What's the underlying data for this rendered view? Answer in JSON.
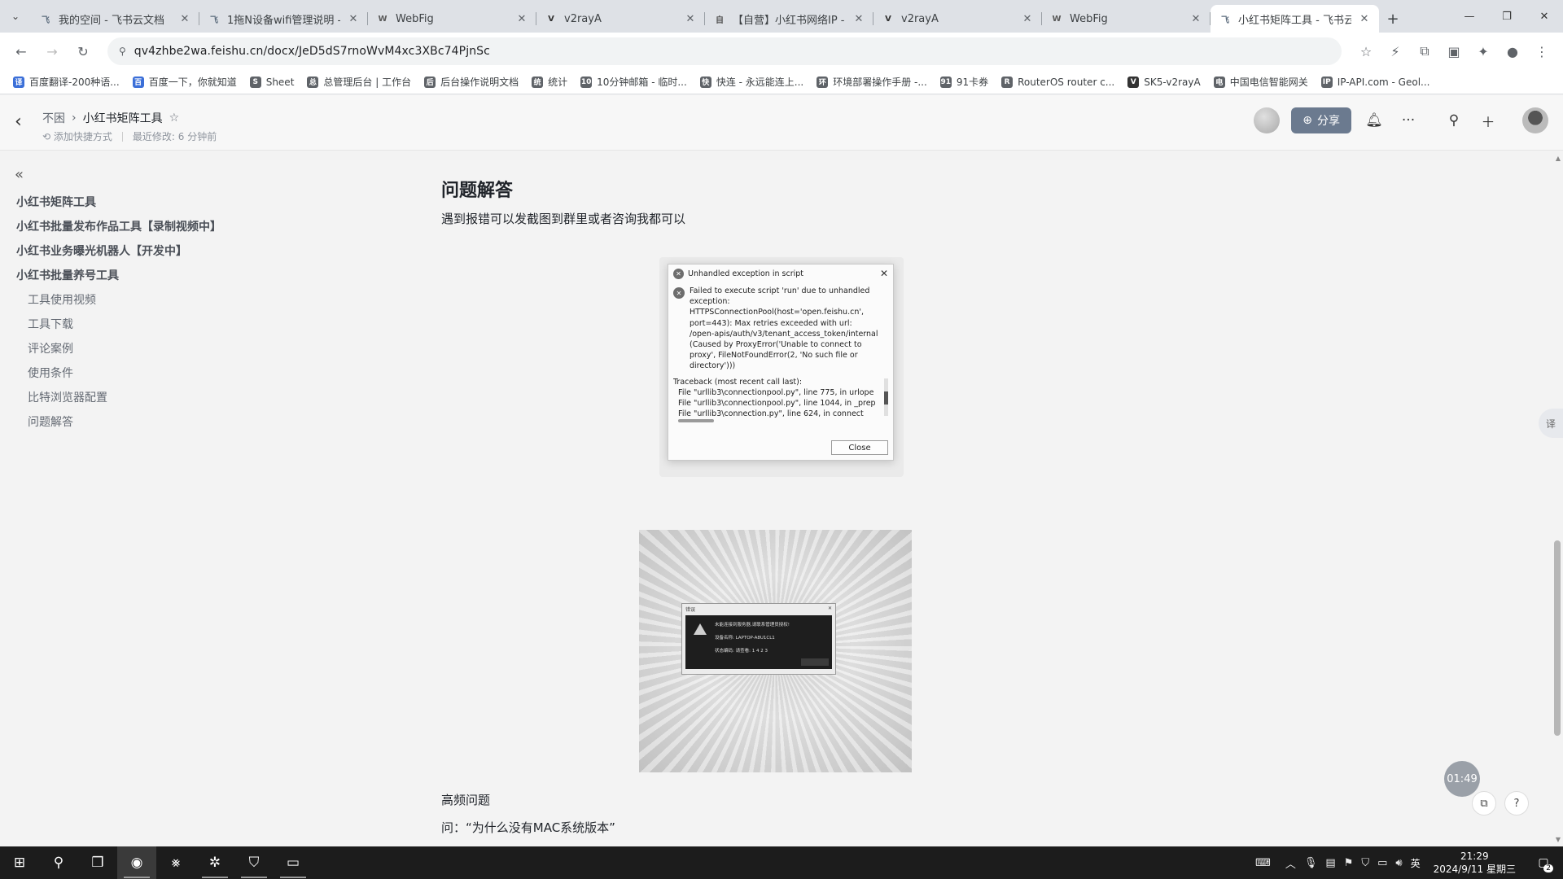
{
  "browser": {
    "tabs": [
      {
        "label": "我的空间 - 飞书云文档",
        "icon": "feishu-doc",
        "color": "#5b6b7c",
        "glyph": "飞"
      },
      {
        "label": "1拖N设备wifi管理说明 -",
        "icon": "feishu-doc",
        "color": "#5b6b7c",
        "glyph": "飞"
      },
      {
        "label": "WebFig",
        "icon": "mikrotik",
        "color": "#5a5a5a",
        "glyph": "W"
      },
      {
        "label": "v2rayA",
        "icon": "v2raya",
        "color": "#333333",
        "glyph": "V"
      },
      {
        "label": "【自营】小红书网络IP - ",
        "icon": "doc",
        "color": "#555555",
        "glyph": "自"
      },
      {
        "label": "v2rayA",
        "icon": "v2raya",
        "color": "#333333",
        "glyph": "V"
      },
      {
        "label": "WebFig",
        "icon": "mikrotik",
        "color": "#5a5a5a",
        "glyph": "W"
      },
      {
        "label": "小红书矩阵工具 - 飞书云",
        "icon": "feishu-doc",
        "color": "#5b6b7c",
        "glyph": "飞"
      }
    ],
    "active_tab_index": 7,
    "new_tab": "+",
    "window_controls": {
      "minimize": "—",
      "restore": "❐",
      "close": "✕"
    },
    "url": "qv4zhbe2wa.feishu.cn/docx/JeD5dS7rnoWvM4xc3XBc74PjnSc",
    "bookmarks": [
      {
        "label": "百度翻译-200种语...",
        "color": "#3b6fd8",
        "glyph": "译"
      },
      {
        "label": "百度一下，你就知道",
        "color": "#3b6fd8",
        "glyph": "百"
      },
      {
        "label": "Sheet",
        "color": "#5f6368",
        "glyph": "S"
      },
      {
        "label": "总管理后台 | 工作台",
        "color": "#5f6368",
        "glyph": "总"
      },
      {
        "label": "后台操作说明文档",
        "color": "#5f6368",
        "glyph": "后"
      },
      {
        "label": "统计",
        "color": "#5f6368",
        "glyph": "统"
      },
      {
        "label": "10分钟邮箱 - 临时...",
        "color": "#5f6368",
        "glyph": "10"
      },
      {
        "label": "快连 - 永远能连上...",
        "color": "#5f6368",
        "glyph": "快"
      },
      {
        "label": "环境部署操作手册 -...",
        "color": "#5f6368",
        "glyph": "环"
      },
      {
        "label": "91卡券",
        "color": "#5f6368",
        "glyph": "91"
      },
      {
        "label": "RouterOS router c...",
        "color": "#5f6368",
        "glyph": "R"
      },
      {
        "label": "SK5-v2rayA",
        "color": "#333333",
        "glyph": "V"
      },
      {
        "label": "中国电信智能网关",
        "color": "#5f6368",
        "glyph": "电"
      },
      {
        "label": "IP-API.com - Geol...",
        "color": "#5f6368",
        "glyph": "IP"
      }
    ]
  },
  "doc_header": {
    "breadcrumb_parent": "不困",
    "breadcrumb_current": "小红书矩阵工具",
    "add_shortcut": "添加快捷方式",
    "last_modified": "最近修改: 6 分钟前",
    "share_label": "分享"
  },
  "sidebar": {
    "items": [
      {
        "label": "小红书矩阵工具",
        "level": 1
      },
      {
        "label": "小红书批量发布作品工具【录制视频中】",
        "level": 1
      },
      {
        "label": "小红书业务曝光机器人【开发中】",
        "level": 1
      },
      {
        "label": "小红书批量养号工具",
        "level": 1
      },
      {
        "label": "工具使用视频",
        "level": 2
      },
      {
        "label": "工具下载",
        "level": 2
      },
      {
        "label": "评论案例",
        "level": 2
      },
      {
        "label": "使用条件",
        "level": 2
      },
      {
        "label": "比特浏览器配置",
        "level": 2
      },
      {
        "label": "问题解答",
        "level": 2
      }
    ]
  },
  "content": {
    "heading": "问题解答",
    "intro": "遇到报错可以发截图到群里或者咨询我都可以",
    "dialog": {
      "title": "Unhandled exception in script",
      "message": "Failed to execute script 'run' due to unhandled\nexception:\nHTTPSConnectionPool(host='open.feishu.cn',\nport=443): Max retries exceeded with url:\n/open-apis/auth/v3/tenant_access_token/internal\n(Caused by ProxyError('Unable to connect to\nproxy', FileNotFoundError(2, 'No such file or\ndirectory')))",
      "traceback_lines": [
        "Traceback (most recent call last):",
        "  File \"urllib3\\connectionpool.py\", line 775, in urlope",
        "  File \"urllib3\\connectionpool.py\", line 1044, in _prep",
        "  File \"urllib3\\connection.py\", line 624, in connect"
      ],
      "close_label": "Close"
    },
    "image2_dialog": {
      "title": "错误",
      "text": "未能连接到服务器,请联系管理员授权!\n            \n设备名称: LAPTOP-A8U1CL1\n\n状态编码: 请查看: 1 4 2 3",
      "close": "✕"
    },
    "faq_heading": "高频问题",
    "faq_q1": "问：“为什么没有MAC系统版本”"
  },
  "floating": {
    "recording_time": "01:49"
  },
  "taskbar": {
    "tray_lang": "英",
    "time": "21:29",
    "date": "2024/9/11 星期三",
    "notification_count": "2"
  }
}
